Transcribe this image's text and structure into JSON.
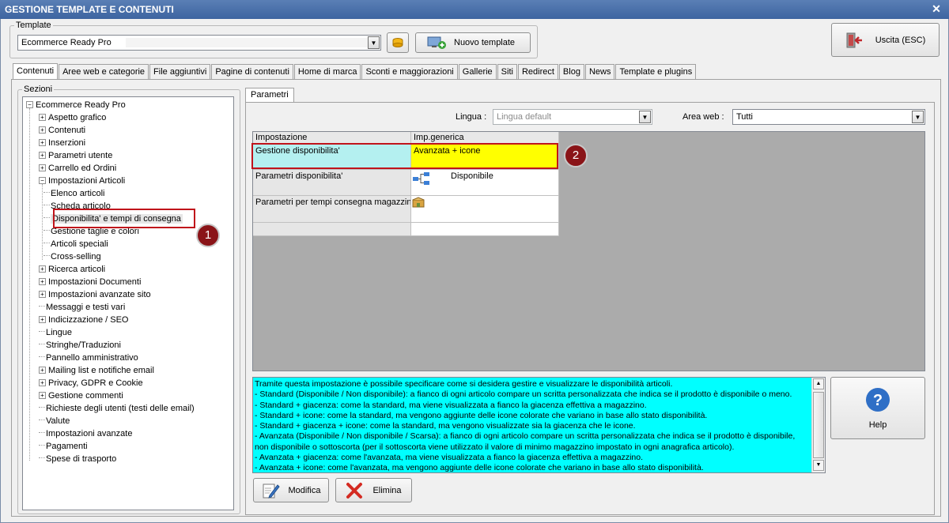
{
  "window": {
    "title": "GESTIONE TEMPLATE E CONTENUTI",
    "close_glyph": "✕"
  },
  "template": {
    "legend": "Template",
    "selected": "Ecommerce Ready Pro",
    "nuovo_label": "Nuovo template"
  },
  "uscita_label": "Uscita (ESC)",
  "tabs": [
    {
      "label": "Contenuti"
    },
    {
      "label": "Aree web e categorie"
    },
    {
      "label": "File aggiuntivi"
    },
    {
      "label": "Pagine di contenuti"
    },
    {
      "label": "Home di marca"
    },
    {
      "label": "Sconti e maggiorazioni"
    },
    {
      "label": "Gallerie"
    },
    {
      "label": "Siti"
    },
    {
      "label": "Redirect"
    },
    {
      "label": "Blog"
    },
    {
      "label": "News"
    },
    {
      "label": "Template e plugins"
    }
  ],
  "sezioni": {
    "legend": "Sezioni",
    "root": "Ecommerce Ready Pro",
    "items": [
      "Aspetto grafico",
      "Contenuti",
      "Inserzioni",
      "Parametri utente",
      "Carrello ed Ordini",
      "Impostazioni Articoli",
      "Elenco articoli",
      "Scheda articolo",
      "Disponibilita' e tempi di consegna",
      "Gestione taglie e colori",
      "Articoli speciali",
      "Cross-selling",
      "Ricerca articoli",
      "Impostazioni Documenti",
      "Impostazioni avanzate sito",
      "Messaggi e testi vari",
      "Indicizzazione / SEO",
      "Lingue",
      "Stringhe/Traduzioni",
      "Pannello amministrativo",
      "Mailing list e notifiche email",
      "Privacy, GDPR e Cookie",
      "Gestione commenti",
      "Richieste degli utenti (testi delle email)",
      "Valute",
      "Impostazioni avanzate",
      "Pagamenti",
      "Spese di trasporto"
    ]
  },
  "markers": {
    "one": "1",
    "two": "2"
  },
  "parametri": {
    "tab_label": "Parametri",
    "lingua_label": "Lingua :",
    "lingua_value": "Lingua default",
    "area_label": "Area web :",
    "area_value": "Tutti",
    "grid": {
      "col_impostazione": "Impostazione",
      "col_imp": "Imp.generica",
      "rows": [
        {
          "name": "Gestione disponibilita'",
          "value": "Avanzata + icone"
        },
        {
          "name": "Parametri disponibilita'",
          "value": "Disponibile"
        },
        {
          "name": "Parametri per tempi consegna magazzini",
          "value": ""
        }
      ]
    },
    "description": "Tramite questa impostazione è possibile specificare come si desidera gestire e visualizzare le disponibilità articoli.\n- Standard (Disponibile / Non disponibile): a fianco di ogni articolo compare un scritta personalizzata che indica se il prodotto è disponibile o meno.\n- Standard + giacenza: come la standard, ma viene visualizzata a fianco la giacenza effettiva a magazzino.\n- Standard + icone: come la standard, ma vengono aggiunte delle icone colorate che variano in base allo stato disponibilità.\n- Standard + giacenza + icone: come la standard, ma vengono visualizzate sia la giacenza che le icone.\n- Avanzata (Disponibile / Non disponibile / Scarsa): a fianco di ogni articolo compare un scritta personalizzata che indica se il prodotto è disponibile,\nnon disponibile o sottoscorta (per il sottoscorta viene utilizzato il valore di minimo magazzino impostato in ogni anagrafica articolo).\n- Avanzata + giacenza: come l'avanzata, ma viene visualizzata a fianco la giacenza effettiva a magazzino.\n- Avanzata + icone: come l'avanzata, ma vengono aggiunte delle icone colorate che variano in base allo stato disponibilità.",
    "help_label": "Help",
    "modifica_label": "Modifica",
    "elimina_label": "Elimina"
  }
}
